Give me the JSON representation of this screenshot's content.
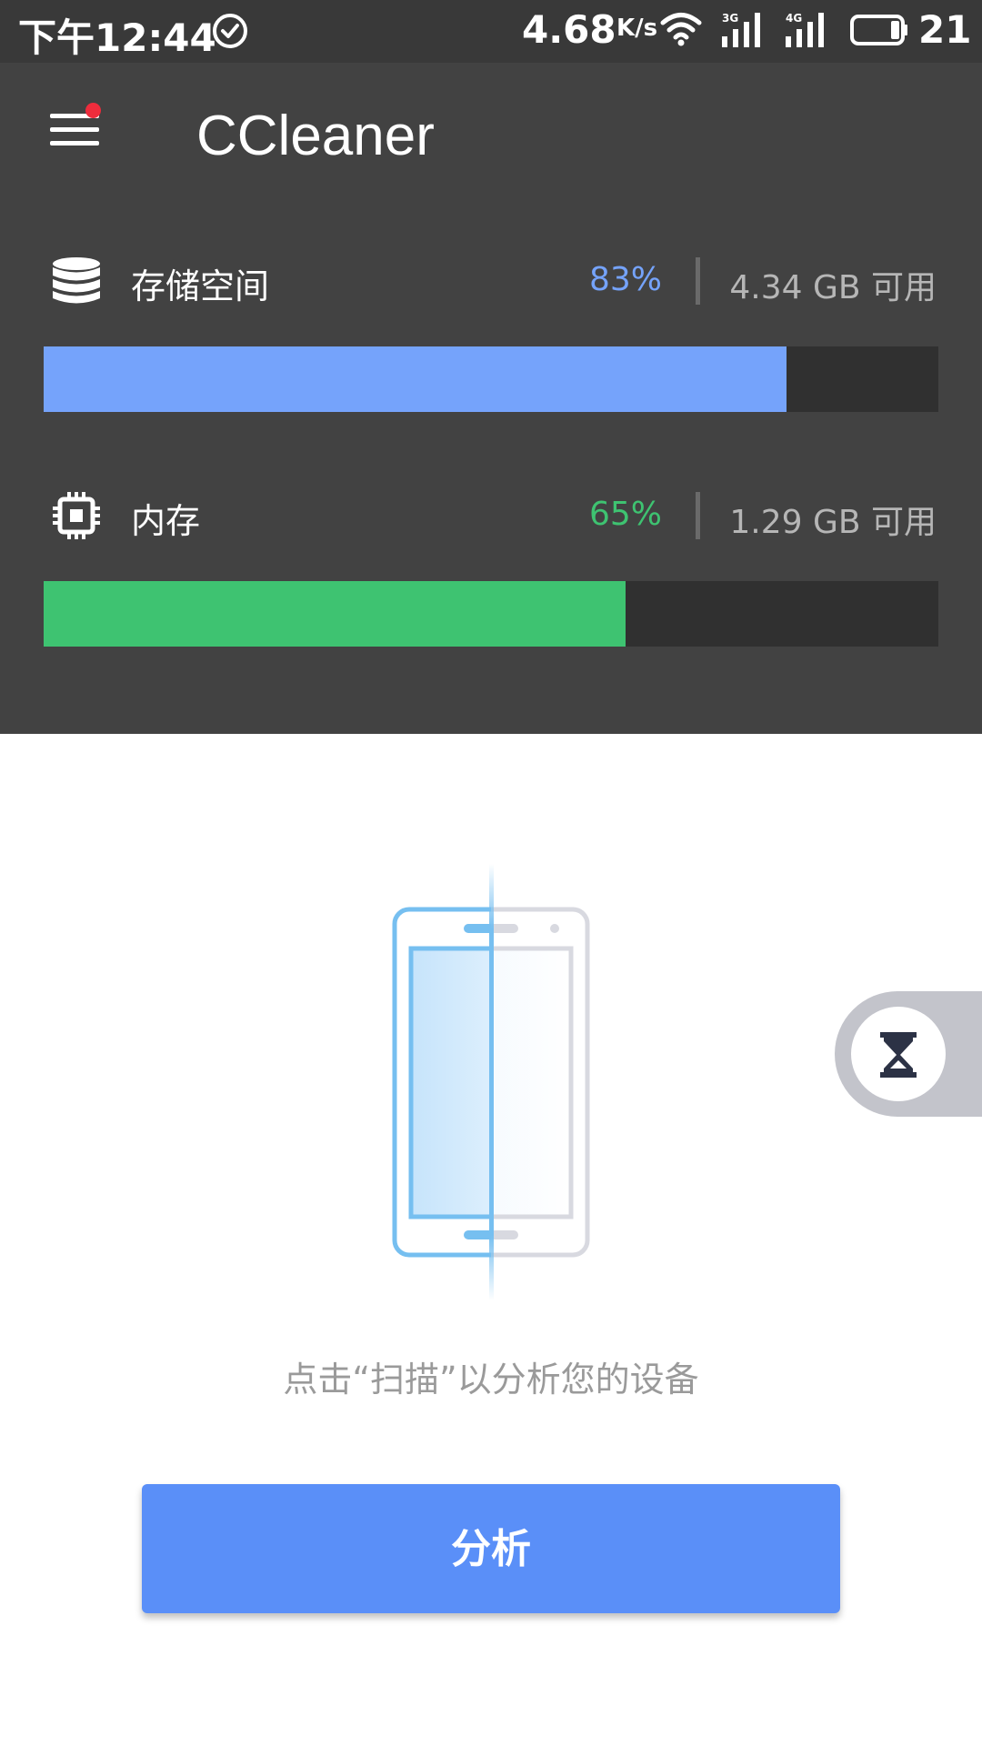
{
  "status_bar": {
    "time": "下午12:44",
    "net_speed": "4.68",
    "net_speed_unit": "K/s",
    "battery_level": "21",
    "icons": [
      "check-circle-icon",
      "wifi-icon",
      "signal-3g-icon",
      "signal-4g-icon",
      "battery-icon"
    ]
  },
  "app": {
    "title": "CCleaner",
    "menu_icon": "hamburger-menu-icon",
    "menu_notification_color": "#ee2c3c"
  },
  "storage": {
    "icon": "database-icon",
    "label": "存储空间",
    "percent_text": "83%",
    "percent": 83,
    "available": "4.34 GB 可用",
    "color": "#75a3fb"
  },
  "memory": {
    "icon": "chip-icon",
    "label": "内存",
    "percent_text": "65%",
    "percent": 65,
    "available": "1.29 GB 可用",
    "color": "#3ec371"
  },
  "main": {
    "illustration_icon": "phone-scan-icon",
    "hint": "点击“扫描”以分析您的设备",
    "analyze_button": "分析",
    "button_color": "#5a8ff8"
  },
  "side_button": {
    "icon": "hourglass-icon"
  }
}
